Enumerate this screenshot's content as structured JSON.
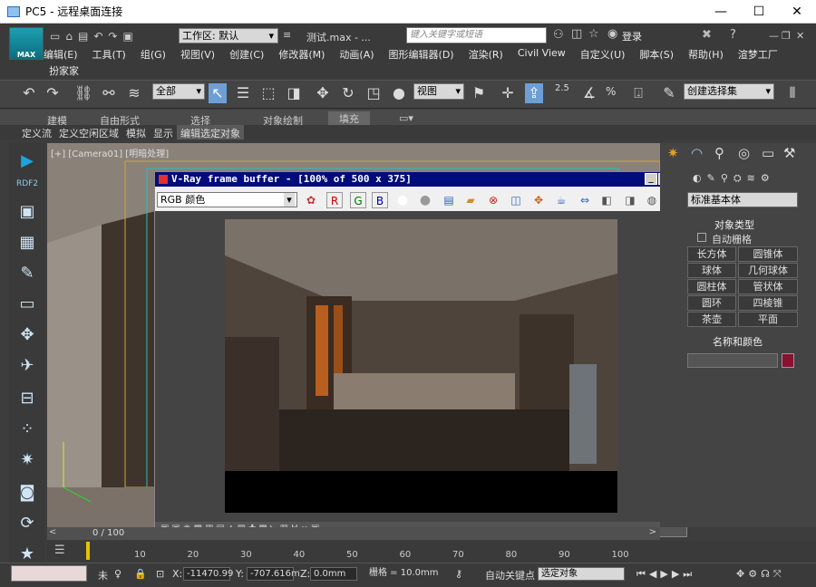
{
  "rdp": {
    "title": "PC5 - 远程桌面连接",
    "minimize": "—",
    "maximize": "☐",
    "close": "✕"
  },
  "app": {
    "logo_label": "MAX",
    "workspace_label": "工作区: 默认",
    "doc_title": "测试.max - ...",
    "search_placeholder": "键入关键字或短语",
    "login_label": "登录",
    "menus_row1": [
      "编辑(E)",
      "工具(T)",
      "组(G)",
      "视图(V)",
      "创建(C)",
      "修改器(M)",
      "动画(A)",
      "图形编辑器(D)",
      "渲染(R)",
      "Civil View",
      "自定义(U)",
      "脚本(S)",
      "帮助(H)",
      "渲梦工厂"
    ],
    "menus_row2": [
      "扮家家"
    ]
  },
  "toolbar": {
    "filter_select": "全部",
    "view_select": "视图",
    "snap_label": "2.5",
    "percent_label": "%",
    "named_selection": "创建选择集"
  },
  "ribbon": {
    "tabs": [
      "建模",
      "自由形式",
      "选择",
      "对象绘制",
      "填充"
    ],
    "subtabs": [
      "定义流",
      "定义空闲区域",
      "模拟",
      "显示",
      "编辑选定对象"
    ]
  },
  "leftbar": {
    "rdf_label": "RDF2"
  },
  "viewport": {
    "label": "[+] [Camera01] [明暗处理]"
  },
  "vray": {
    "title": "V-Ray frame buffer - [100% of 500 x 375]",
    "channel_select": "RGB 颜色",
    "btn_r": "R",
    "btn_g": "G",
    "btn_b": "B"
  },
  "rightpanel": {
    "category_select": "标准基本体",
    "object_type_header": "对象类型",
    "autogrid_label": "自动栅格",
    "objects": [
      "长方体",
      "圆锥体",
      "球体",
      "几何球体",
      "圆柱体",
      "管状体",
      "圆环",
      "四棱锥",
      "茶壶",
      "平面"
    ],
    "name_color_header": "名称和颜色",
    "object_color": "#8a1030"
  },
  "timeline": {
    "range_label": "0 / 100",
    "ticks": [
      "10",
      "20",
      "30",
      "40",
      "50",
      "60",
      "70",
      "80",
      "90",
      "100"
    ]
  },
  "status": {
    "none_label": "未",
    "x_label": "X:",
    "x_value": "-11470.99",
    "y_label": "Y:",
    "y_value": "-707.616m",
    "z_label": "Z:",
    "z_value": "0.0mm",
    "grid_label": "栅格 = 10.0mm",
    "autokey_label": "自动关键点",
    "selection_select": "选定对象"
  }
}
